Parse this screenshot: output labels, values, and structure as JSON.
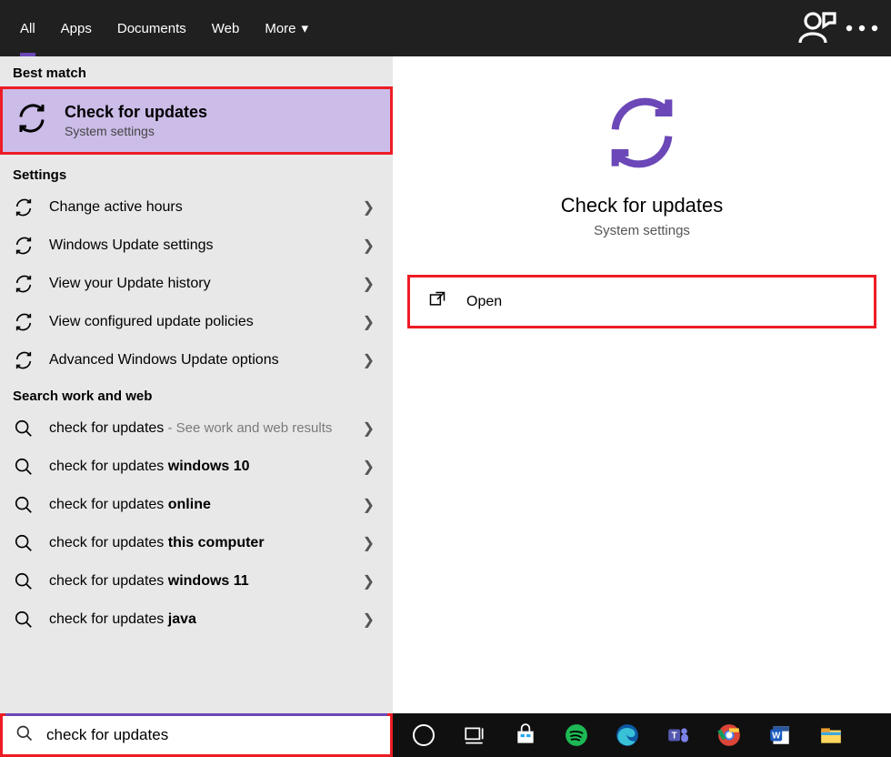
{
  "tabs": {
    "all": "All",
    "apps": "Apps",
    "documents": "Documents",
    "web": "Web",
    "more": "More"
  },
  "sections": {
    "best_match": "Best match",
    "settings": "Settings",
    "search_web": "Search work and web"
  },
  "best_match": {
    "title": "Check for updates",
    "subtitle": "System settings"
  },
  "settings_items": [
    "Change active hours",
    "Windows Update settings",
    "View your Update history",
    "View configured update policies",
    "Advanced Windows Update options"
  ],
  "web_items": [
    {
      "prefix": "check for updates",
      "suffix": "",
      "hint": " - See work and web results"
    },
    {
      "prefix": "check for updates ",
      "suffix": "windows 10",
      "hint": ""
    },
    {
      "prefix": "check for updates ",
      "suffix": "online",
      "hint": ""
    },
    {
      "prefix": "check for updates ",
      "suffix": "this computer",
      "hint": ""
    },
    {
      "prefix": "check for updates ",
      "suffix": "windows 11",
      "hint": ""
    },
    {
      "prefix": "check for updates ",
      "suffix": "java",
      "hint": ""
    }
  ],
  "detail": {
    "title": "Check for updates",
    "subtitle": "System settings",
    "open": "Open"
  },
  "search": {
    "value": "check for updates"
  }
}
